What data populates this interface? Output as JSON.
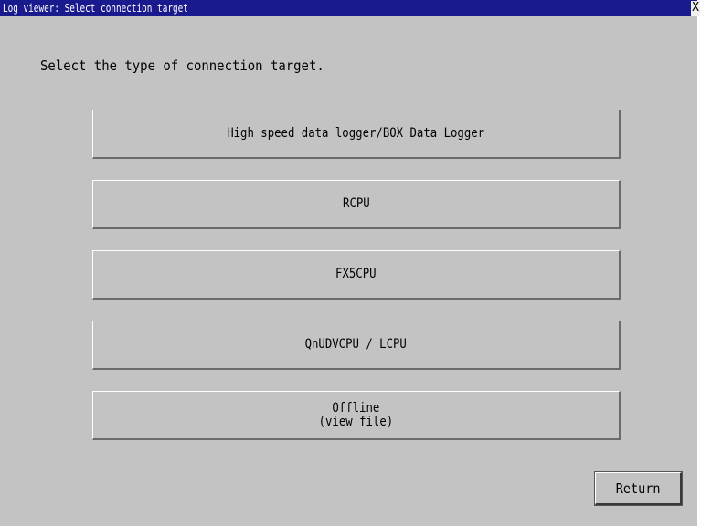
{
  "window": {
    "title": "Log viewer: Select connection target",
    "close_glyph": "X"
  },
  "prompt": "Select the type of connection target.",
  "options": [
    {
      "label": "High speed data logger/BOX Data Logger"
    },
    {
      "label": "RCPU"
    },
    {
      "label": "FX5CPU"
    },
    {
      "label": "QnUDVCPU / LCPU"
    },
    {
      "label": "Offline\n(view file)"
    }
  ],
  "footer": {
    "return_label": "Return"
  },
  "colors": {
    "titlebar": "#1a1a8f",
    "background": "#c3c3c3"
  }
}
